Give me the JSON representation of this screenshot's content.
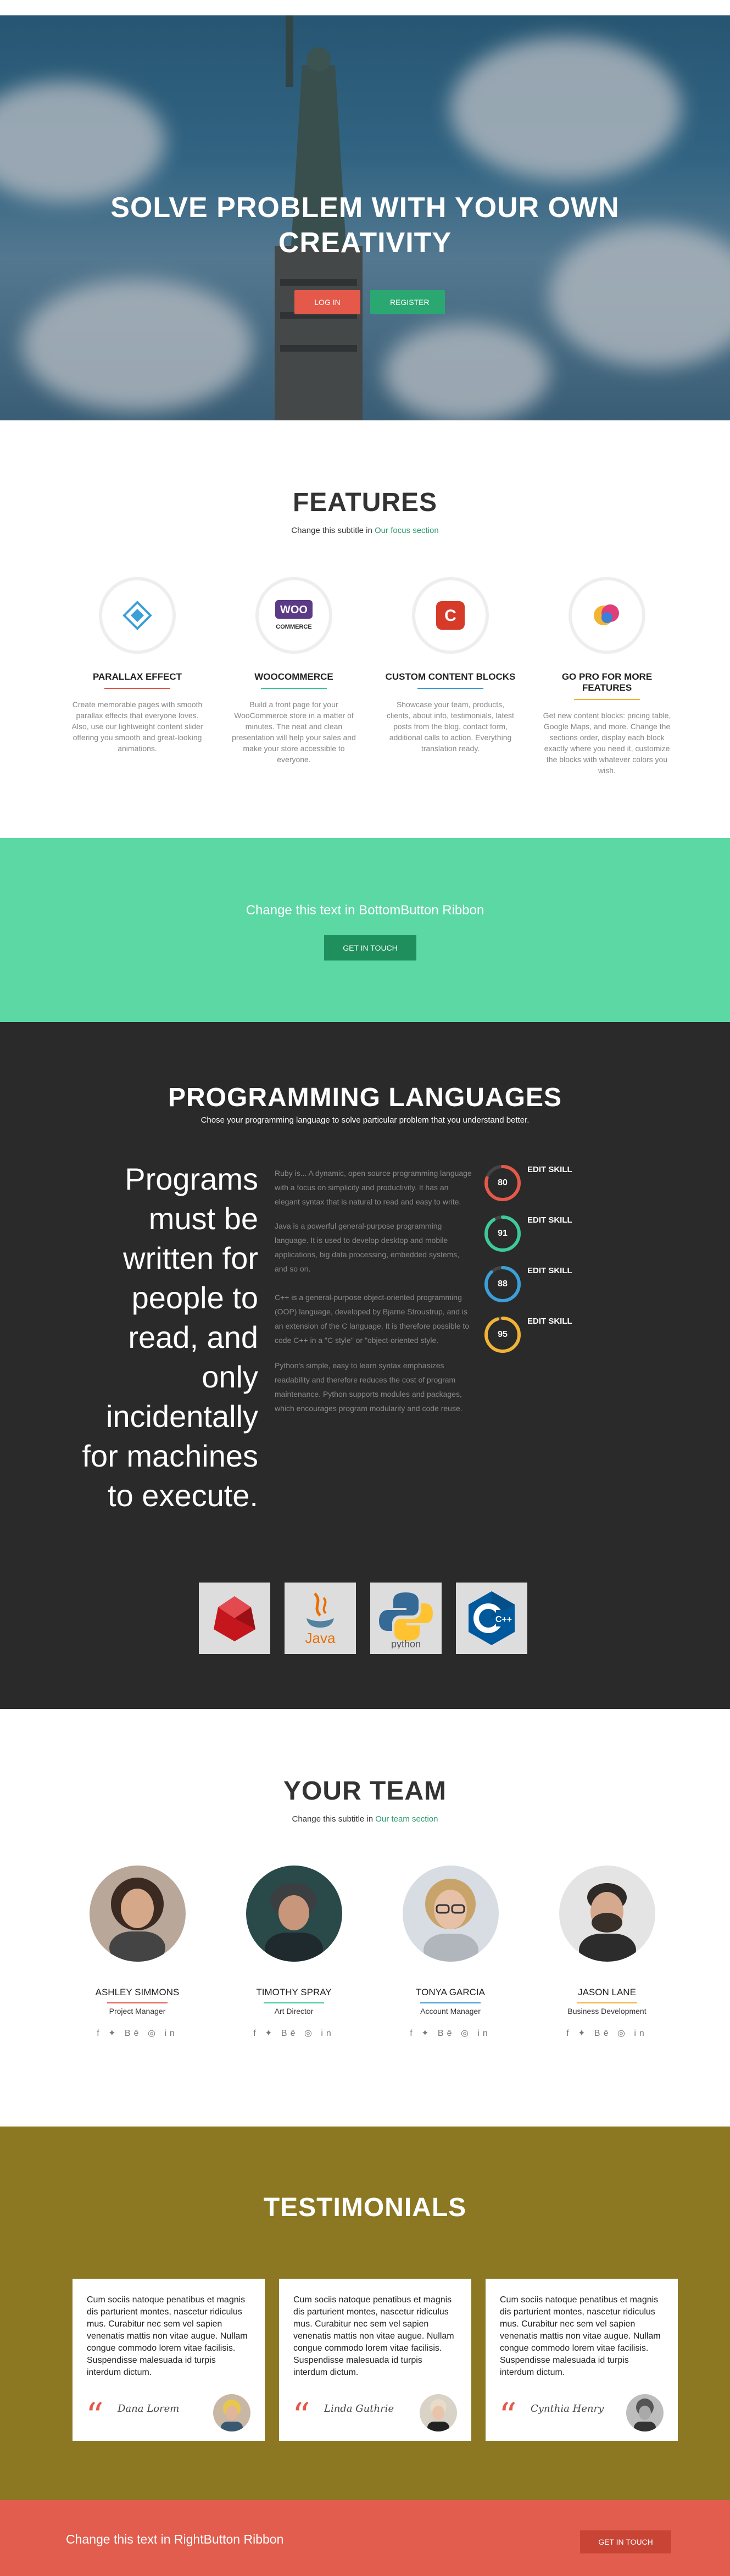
{
  "hero": {
    "title_line1": "SOLVE PROBLEM WITH YOUR OWN",
    "title_line2": "CREATIVITY",
    "login_label": "LOG IN",
    "register_label": "REGISTER"
  },
  "features": {
    "title": "FEATURES",
    "subtitle_prefix": "Change this subtitle in ",
    "subtitle_highlight": "Our focus section",
    "items": [
      {
        "name": "PARALLAX EFFECT",
        "icon": "parallax-icon",
        "text": "Create memorable pages with smooth parallax effects that everyone loves. Also, use our lightweight content slider offering you smooth and great-looking animations."
      },
      {
        "name": "WOOCOMMERCE",
        "icon": "woocommerce-icon",
        "text": "Build a front page for your WooCommerce store in a matter of minutes. The neat and clean presentation will help your sales and make your store accessible to everyone."
      },
      {
        "name": "CUSTOM CONTENT BLOCKS",
        "icon": "content-blocks-icon",
        "text": "Showcase your team, products, clients, about info, testimonials, latest posts from the blog, contact form, additional calls to action. Everything translation ready."
      },
      {
        "name": "GO PRO FOR MORE FEATURES",
        "icon": "go-pro-icon",
        "text": "Get new content blocks: pricing table, Google Maps, and more. Change the sections order, display each block exactly where you need it, customize the blocks with whatever colors you wish."
      }
    ]
  },
  "ribbon_bottom": {
    "text": "Change this text in BottomButton Ribbon",
    "button_label": "GET IN TOUCH"
  },
  "programming": {
    "title": "PROGRAMMING LANGUAGES",
    "subtitle": "Chose your programming language to solve particular problem that you understand better.",
    "quote_lines": [
      "Programs",
      "must be",
      "written for",
      "people to",
      "read, and",
      "only",
      "incidentally",
      "for machines",
      "to execute."
    ],
    "paragraphs": [
      "Ruby is... A dynamic, open source programming language with a focus on simplicity and productivity. It has an elegant syntax that is natural to read and easy to write.",
      "Java is a powerful general-purpose programming language. It is used to develop desktop and mobile applications, big data processing, embedded systems, and so on.",
      "C++ is a general-purpose object-oriented programming (OOP) language, developed by Bjarne Stroustrup, and is an extension of the C language. It is therefore possible to code C++ in a \"C style\" or \"object-oriented style.",
      "Python's simple, easy to learn syntax emphasizes readability and therefore reduces the cost of program maintenance. Python supports modules and packages, which encourages program modularity and code reuse."
    ],
    "skills": [
      {
        "value": 80,
        "label": "EDIT SKILL",
        "color": "#e4594a"
      },
      {
        "value": 91,
        "label": "EDIT SKILL",
        "color": "#3ec99a"
      },
      {
        "value": 88,
        "label": "EDIT SKILL",
        "color": "#3b9fd8"
      },
      {
        "value": 95,
        "label": "EDIT SKILL",
        "color": "#f1b335"
      }
    ],
    "logos": [
      {
        "name": "ruby-logo",
        "text": ""
      },
      {
        "name": "java-logo",
        "text": "Java"
      },
      {
        "name": "python-logo",
        "text": "python"
      },
      {
        "name": "cpp-logo",
        "text": "C++"
      }
    ]
  },
  "team": {
    "title": "YOUR TEAM",
    "subtitle_prefix": "Change this subtitle in ",
    "subtitle_highlight": "Our team section",
    "social_icons": "f  ✦  Bē  ◎  in",
    "members": [
      {
        "name": "ASHLEY SIMMONS",
        "role": "Project Manager",
        "line_color": "#e4594a"
      },
      {
        "name": "TIMOTHY SPRAY",
        "role": "Art Director",
        "line_color": "#3ec99a"
      },
      {
        "name": "TONYA GARCIA",
        "role": "Account Manager",
        "line_color": "#3b9fd8"
      },
      {
        "name": "JASON LANE",
        "role": "Business Development",
        "line_color": "#f1b335"
      }
    ]
  },
  "testimonials": {
    "title": "TESTIMONIALS",
    "items": [
      {
        "text": "Cum sociis natoque penatibus et magnis dis parturient montes, nascetur ridiculus mus. Curabitur nec sem vel sapien venenatis mattis non vitae augue. Nullam congue commodo lorem vitae facilisis. Suspendisse malesuada id turpis interdum dictum.",
        "signature": "Dana Lorem"
      },
      {
        "text": "Cum sociis natoque penatibus et magnis dis parturient montes, nascetur ridiculus mus. Curabitur nec sem vel sapien venenatis mattis non vitae augue. Nullam congue commodo lorem vitae facilisis. Suspendisse malesuada id turpis interdum dictum.",
        "signature": "Linda Guthrie"
      },
      {
        "text": "Cum sociis natoque penatibus et magnis dis parturient montes, nascetur ridiculus mus. Curabitur nec sem vel sapien venenatis mattis non vitae augue. Nullam congue commodo lorem vitae facilisis. Suspendisse malesuada id turpis interdum dictum.",
        "signature": "Cynthia Henry"
      }
    ]
  },
  "ribbon_right": {
    "text": "Change this text in RightButton Ribbon",
    "button_label": "GET IN TOUCH"
  }
}
